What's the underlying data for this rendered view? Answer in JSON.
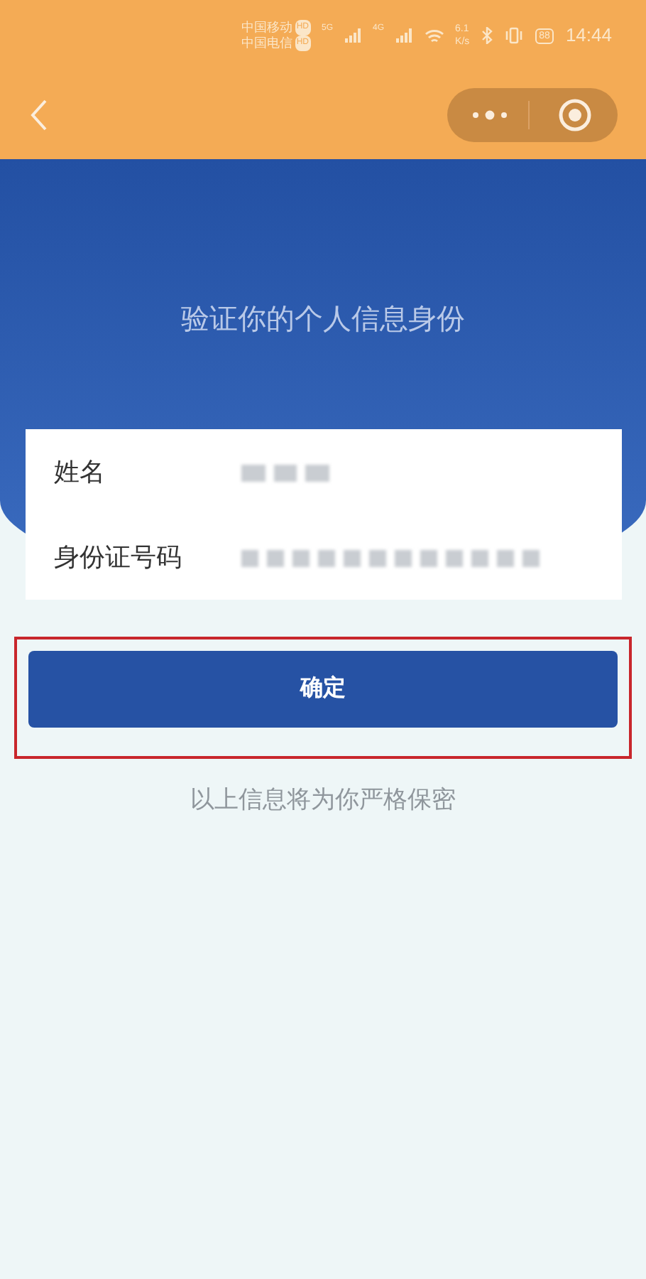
{
  "status_bar": {
    "carrier_1": "中国移动",
    "carrier_1_badge": "HD",
    "carrier_2": "中国电信",
    "carrier_2_badge": "HD",
    "network_1": "5G",
    "network_2": "4G",
    "speed": "6.1",
    "speed_unit": "K/s",
    "battery": "88",
    "time": "14:44"
  },
  "title": "验证你的个人信息身份",
  "fields": [
    {
      "label": "姓名"
    },
    {
      "label": "身份证号码"
    }
  ],
  "confirm_button": {
    "label": "确定",
    "highlighted": true
  },
  "notice": "以上信息将为你严格保密"
}
